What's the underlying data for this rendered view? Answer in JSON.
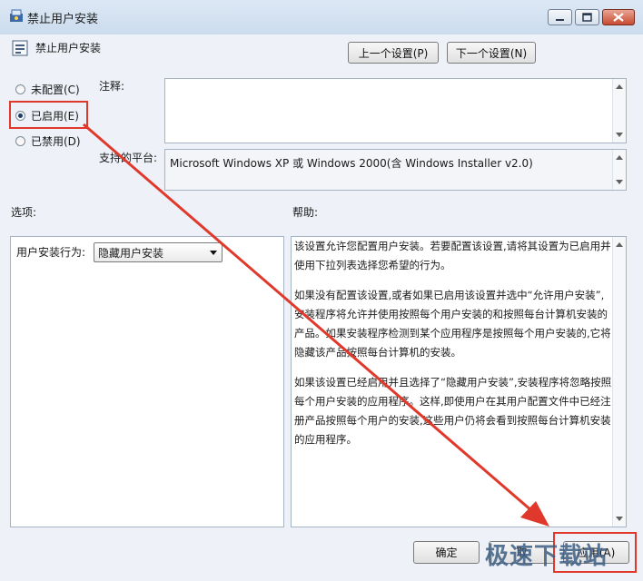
{
  "window": {
    "title": "禁止用户安装"
  },
  "policy": {
    "name": "禁止用户安装"
  },
  "nav": {
    "prev_label": "上一个设置(P)",
    "next_label": "下一个设置(N)"
  },
  "state_options": [
    {
      "label": "未配置(C)",
      "selected": false
    },
    {
      "label": "已启用(E)",
      "selected": true
    },
    {
      "label": "已禁用(D)",
      "selected": false
    }
  ],
  "comment": {
    "label": "注释:",
    "value": ""
  },
  "platform": {
    "label": "支持的平台:",
    "value": "Microsoft Windows XP 或 Windows 2000(含 Windows Installer v2.0)"
  },
  "options": {
    "label": "选项:",
    "behavior_label": "用户安装行为:",
    "behavior_value": "隐藏用户安装"
  },
  "help": {
    "label": "帮助:",
    "paragraphs": [
      "该设置允许您配置用户安装。若要配置该设置,请将其设置为已启用并使用下拉列表选择您希望的行为。",
      "如果没有配置该设置,或者如果已启用该设置并选中“允许用户安装”,安装程序将允许并使用按照每个用户安装的和按照每台计算机安装的产品。如果安装程序检测到某个应用程序是按照每个用户安装的,它将隐藏该产品按照每台计算机的安装。",
      "如果该设置已经启用并且选择了“隐藏用户安装”,安装程序将忽略按照每个用户安装的应用程序。这样,即使用户在其用户配置文件中已经注册产品按照每个用户的安装,这些用户仍将会看到按照每台计算机安装的应用程序。"
    ]
  },
  "footer": {
    "ok_label": "确定",
    "cancel_label": "取",
    "apply_label": "应用(A)"
  },
  "watermark": {
    "text": "极速下载站"
  },
  "annotation": {
    "color": "#e0392b"
  }
}
